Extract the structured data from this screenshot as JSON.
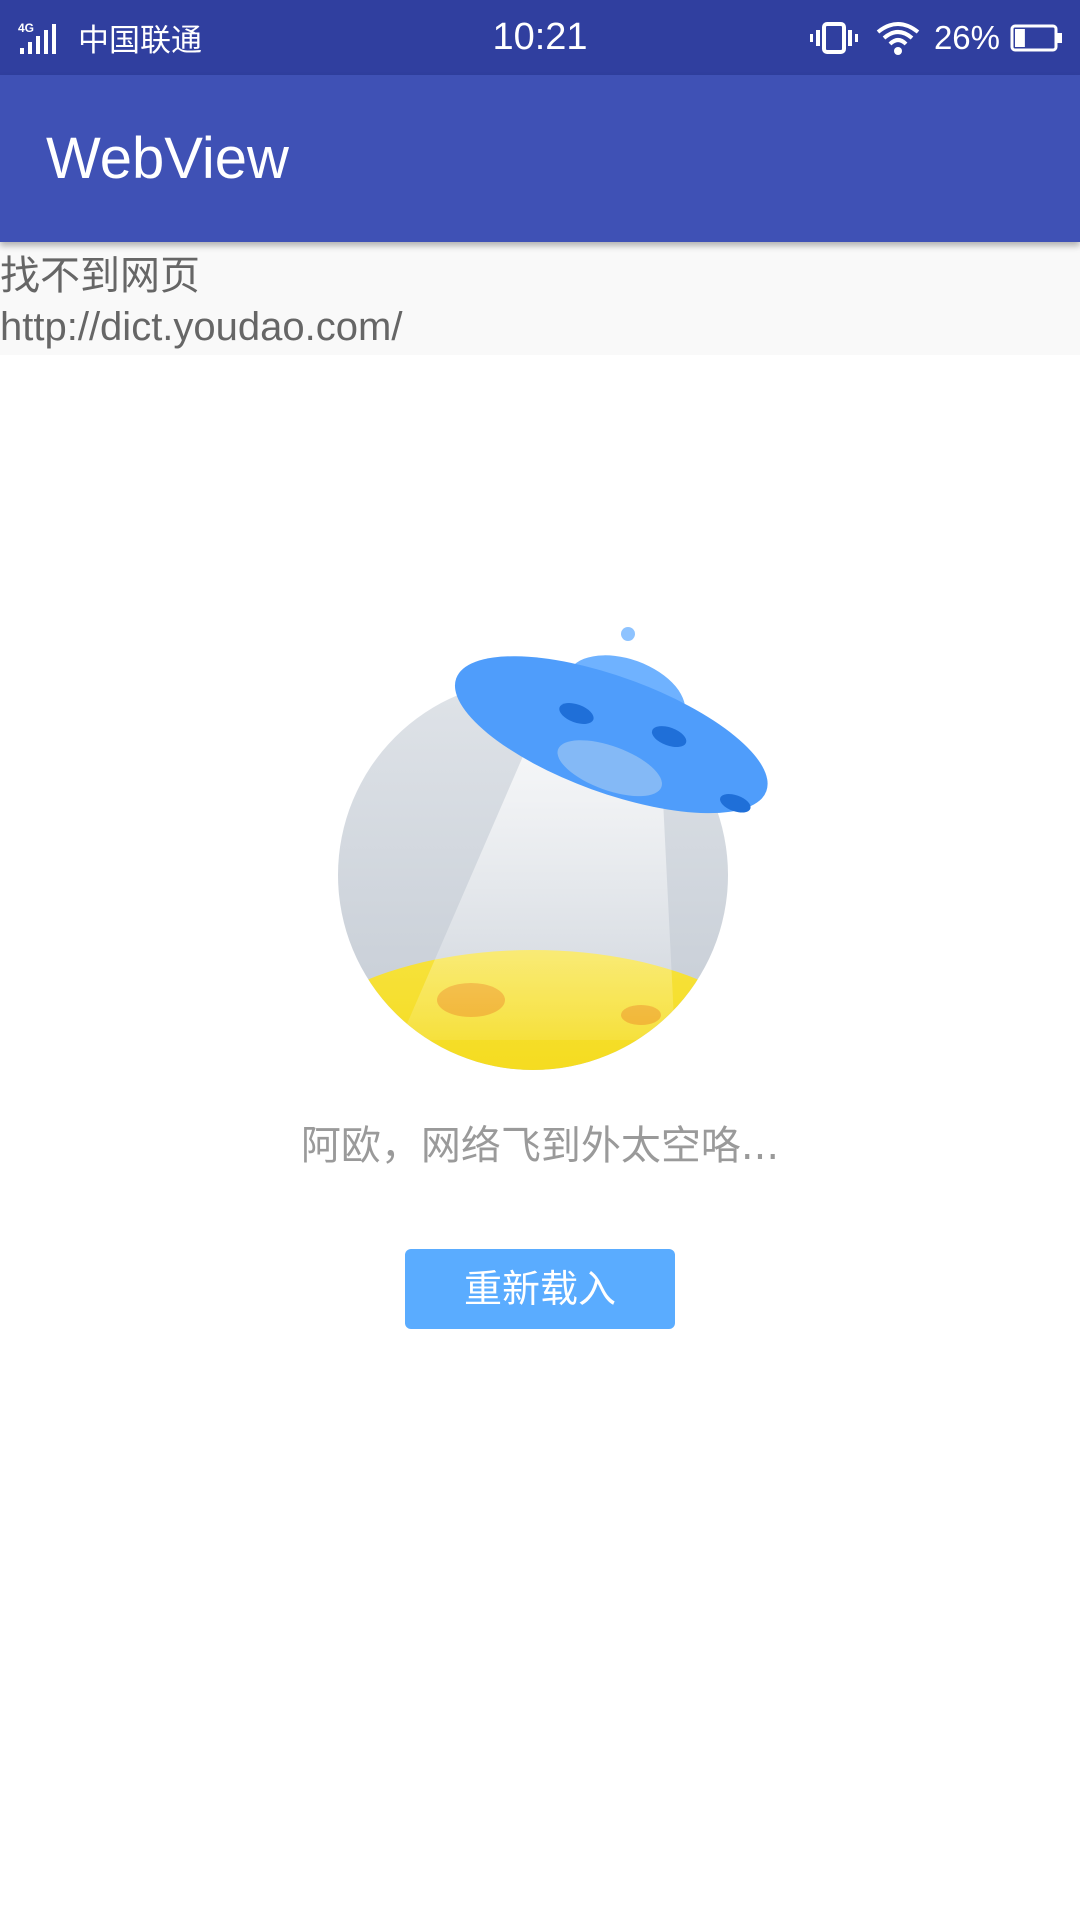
{
  "status_bar": {
    "network_type": "4G",
    "carrier": "中国联通",
    "time": "10:21",
    "battery_percent": "26%",
    "battery_level": 0.26,
    "icons": [
      "signal-icon",
      "vibrate-icon",
      "wifi-icon",
      "battery-icon"
    ]
  },
  "app_bar": {
    "title": "WebView",
    "color": "#3f51b5",
    "status_color": "#303f9f"
  },
  "error_page": {
    "title": "找不到网页",
    "url": "http://dict.youdao.com/",
    "illustration": "ufo-over-moon-illustration",
    "message": "阿欧，网络飞到外太空咯...",
    "reload_label": "重新载入",
    "button_color": "#5aacff"
  }
}
